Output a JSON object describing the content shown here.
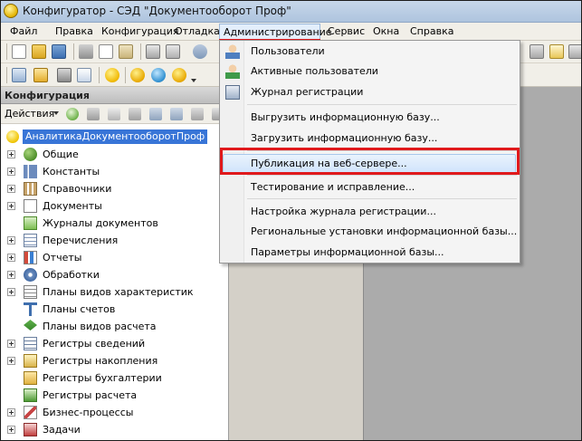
{
  "window": {
    "title": "Конфигуратор - СЭД \"Документооборот Проф\""
  },
  "menubar": {
    "items": [
      {
        "label": "Файл"
      },
      {
        "label": "Правка"
      },
      {
        "label": "Конфигурация"
      },
      {
        "label": "Отладка"
      },
      {
        "label": "Администрирование"
      },
      {
        "label": "Сервис"
      },
      {
        "label": "Окна"
      },
      {
        "label": "Справка"
      }
    ]
  },
  "panel": {
    "title": "Конфигурация",
    "actions_label": "Действия",
    "root": "АналитикаДокументооборотПроф",
    "tree": [
      {
        "label": "Общие",
        "icon": "common-icon",
        "expandable": true
      },
      {
        "label": "Константы",
        "icon": "constants-icon",
        "expandable": true
      },
      {
        "label": "Справочники",
        "icon": "catalogs-icon",
        "expandable": true
      },
      {
        "label": "Документы",
        "icon": "documents-icon",
        "expandable": true
      },
      {
        "label": "Журналы документов",
        "icon": "journals-icon",
        "expandable": false
      },
      {
        "label": "Перечисления",
        "icon": "enums-icon",
        "expandable": true
      },
      {
        "label": "Отчеты",
        "icon": "reports-icon",
        "expandable": true
      },
      {
        "label": "Обработки",
        "icon": "dataprocessors-icon",
        "expandable": true
      },
      {
        "label": "Планы видов характеристик",
        "icon": "chart-of-characteristic-types-icon",
        "expandable": true
      },
      {
        "label": "Планы счетов",
        "icon": "chart-of-accounts-icon",
        "expandable": false
      },
      {
        "label": "Планы видов расчета",
        "icon": "chart-of-calculation-types-icon",
        "expandable": false
      },
      {
        "label": "Регистры сведений",
        "icon": "information-registers-icon",
        "expandable": true
      },
      {
        "label": "Регистры накопления",
        "icon": "accumulation-registers-icon",
        "expandable": true
      },
      {
        "label": "Регистры бухгалтерии",
        "icon": "accounting-registers-icon",
        "expandable": false
      },
      {
        "label": "Регистры расчета",
        "icon": "calculation-registers-icon",
        "expandable": false
      },
      {
        "label": "Бизнес-процессы",
        "icon": "business-processes-icon",
        "expandable": true
      },
      {
        "label": "Задачи",
        "icon": "tasks-icon",
        "expandable": true
      }
    ]
  },
  "dropdown": {
    "items": [
      {
        "label": "Пользователи",
        "icon": "users-icon"
      },
      {
        "label": "Активные пользователи",
        "icon": "active-users-icon"
      },
      {
        "label": "Журнал регистрации",
        "icon": "event-log-icon"
      },
      {
        "label": "Выгрузить информационную базу..."
      },
      {
        "label": "Загрузить информационную базу..."
      },
      {
        "label": "Публикация на веб-сервере..."
      },
      {
        "label": "Тестирование и исправление..."
      },
      {
        "label": "Настройка журнала регистрации..."
      },
      {
        "label": "Региональные установки информационной базы..."
      },
      {
        "label": "Параметры информационной базы..."
      }
    ]
  },
  "colors": {
    "highlight_red": "#e0191c",
    "selection_blue": "#3875d7",
    "menu_hover": "#cfe3fb"
  }
}
